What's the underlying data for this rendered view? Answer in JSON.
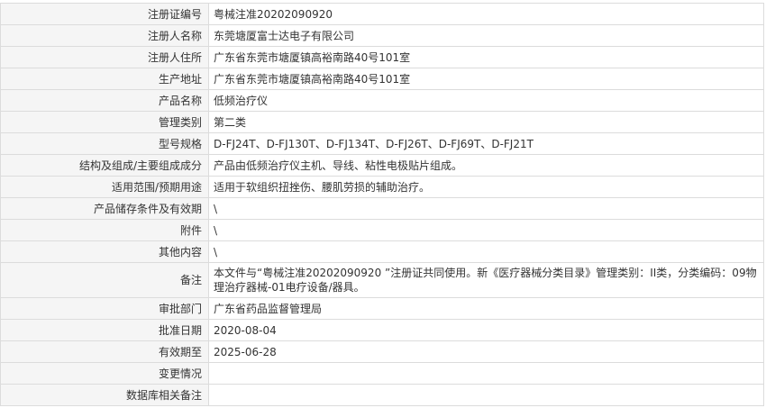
{
  "rows": [
    {
      "label": "注册证编号",
      "value": "粤械注准20202090920"
    },
    {
      "label": "注册人名称",
      "value": "东莞塘厦富士达电子有限公司"
    },
    {
      "label": "注册人住所",
      "value": "广东省东莞市塘厦镇高裕南路40号101室"
    },
    {
      "label": "生产地址",
      "value": "广东省东莞市塘厦镇高裕南路40号101室"
    },
    {
      "label": "产品名称",
      "value": "低频治疗仪"
    },
    {
      "label": "管理类别",
      "value": "第二类"
    },
    {
      "label": "型号规格",
      "value": "D-FJ24T、D-FJ130T、D-FJ134T、D-FJ26T、D-FJ69T、D-FJ21T"
    },
    {
      "label": "结构及组成/主要组成成分",
      "value": "产品由低频治疗仪主机、导线、粘性电极贴片组成。"
    },
    {
      "label": "适用范围/预期用途",
      "value": "适用于软组织扭挫伤、腰肌劳损的辅助治疗。"
    },
    {
      "label": "产品储存条件及有效期",
      "value": "\\"
    },
    {
      "label": "附件",
      "value": "\\"
    },
    {
      "label": "其他内容",
      "value": "\\"
    },
    {
      "label": "备注",
      "value": "本文件与“粤械注准20202090920 ”注册证共同使用。新《医疗器械分类目录》管理类别：II类，分类编码：09物理治疗器械-01电疗设备/器具。"
    },
    {
      "label": "审批部门",
      "value": "广东省药品监督管理局"
    },
    {
      "label": "批准日期",
      "value": "2020-08-04"
    },
    {
      "label": "有效期至",
      "value": "2025-06-28"
    },
    {
      "label": "变更情况",
      "value": ""
    },
    {
      "label": "数据库相关备注",
      "value": ""
    }
  ]
}
